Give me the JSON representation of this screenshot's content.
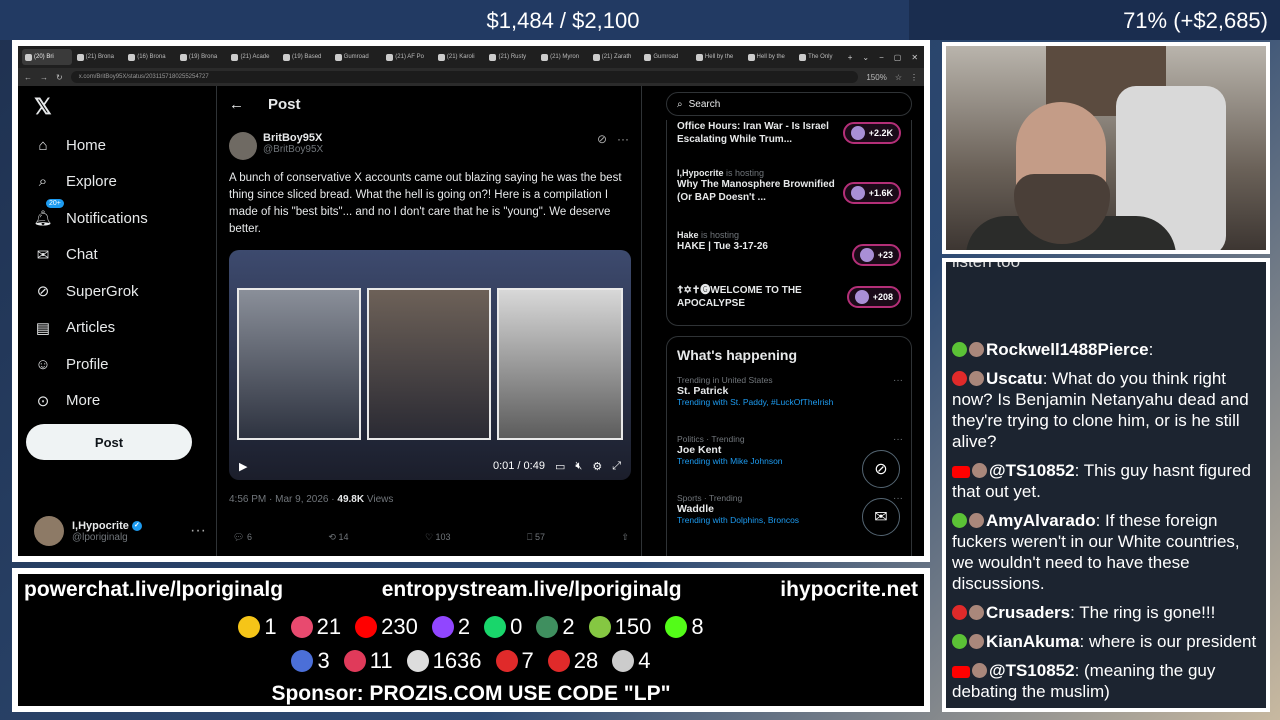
{
  "goal": {
    "amount": "$1,484 / $2,100",
    "percent": "71% (+$2,685)",
    "progress": 0.71
  },
  "browser": {
    "tabs": [
      "(20) Bri",
      "(21) Brona",
      "(16) Brona",
      "(19) Brona",
      "(21) Acade",
      "(19) Based",
      "Gumroad",
      "(21) AF Po",
      "(21) Karoli",
      "(21) Rusty",
      "(21) Myron",
      "(21) Zarath",
      "Gumroad",
      "Hell by the",
      "Hell by the",
      "The Only"
    ],
    "url": "x.com/BritBoy95X/status/2031157180255254727",
    "zoom": "150%"
  },
  "xnav": {
    "items": [
      {
        "label": "Home",
        "icon": "home-icon"
      },
      {
        "label": "Explore",
        "icon": "search-icon"
      },
      {
        "label": "Notifications",
        "icon": "bell-icon",
        "badge": "20+"
      },
      {
        "label": "Chat",
        "icon": "mail-icon"
      },
      {
        "label": "SuperGrok",
        "icon": "grok-icon"
      },
      {
        "label": "Articles",
        "icon": "articles-icon"
      },
      {
        "label": "Profile",
        "icon": "profile-icon"
      },
      {
        "label": "More",
        "icon": "more-icon"
      }
    ],
    "post_button": "Post",
    "me": {
      "name": "I,Hypocrite",
      "handle": "@lporiginalg"
    }
  },
  "post": {
    "header": "Post",
    "author_name": "BritBoy95X",
    "author_handle": "@BritBoy95X",
    "text": "A bunch of conservative X accounts came out blazing saying he was the best thing since sliced bread. What the hell is going on?! Here is a compilation I made of his \"best bits\"... and no I don't care that he is \"young\". We deserve better.",
    "video_time": "0:01 / 0:49",
    "timestamp": "4:56 PM · Mar 9, 2026 · ",
    "views_count": "49.8K",
    "views_label": " Views",
    "replies": "6",
    "reposts": "14",
    "likes": "103",
    "bookmarks": "57"
  },
  "rightcol": {
    "search_placeholder": "Search",
    "spaces": [
      {
        "host": "",
        "hosting": "",
        "title": "Office Hours: Iran War - Is Israel Escalating While Trum...",
        "count": "+2.2K"
      },
      {
        "host": "I,Hypocrite",
        "hosting": " is hosting",
        "title": "Why The Manosphere Brownified (Or BAP Doesn't ...",
        "count": "+1.6K"
      },
      {
        "host": "Hake",
        "hosting": " is hosting",
        "title": "HAKE | Tue 3-17-26",
        "count": "+23"
      },
      {
        "host": "",
        "hosting": "",
        "title": "☦✡✝🅖WELCOME TO THE APOCALYPSE",
        "count": "+208"
      }
    ],
    "happening_title": "What's happening",
    "trends": [
      {
        "cat": "Trending in United States",
        "name": "St. Patrick",
        "with_label": "Trending with ",
        "with": "St. Paddy, #LuckOfTheIrish"
      },
      {
        "cat": "Politics · Trending",
        "name": "Joe Kent",
        "with_label": "Trending with ",
        "with": "Mike Johnson"
      },
      {
        "cat": "Sports · Trending",
        "name": "Waddle",
        "with_label": "Trending with ",
        "with": "Dolphins, Broncos"
      }
    ]
  },
  "chat": {
    "cutoff": "listen too",
    "messages": [
      {
        "user": "Rockwell1488Pierce",
        "text": ": ",
        "platform": "rumble"
      },
      {
        "user": "Uscatu",
        "text": ": What do you think right now? Is Benjamin Netanyahu dead and they're trying to clone him, or is he still alive?",
        "platform": "odysee"
      },
      {
        "user": "@TS10852",
        "text": ": This guy hasnt figured that out yet.",
        "platform": "youtube"
      },
      {
        "user": "AmyAlvarado",
        "text": ": If these foreign fuckers weren't in our White countries, we wouldn't need to have these discussions.",
        "platform": "rumble"
      },
      {
        "user": "Crusaders",
        "text": ": The ring is gone!!!",
        "platform": "odysee"
      },
      {
        "user": "KianAkuma",
        "text": ": where is our president",
        "platform": "rumble"
      },
      {
        "user": "@TS10852",
        "text": ": (meaning the guy debating the muslim)",
        "platform": "youtube"
      }
    ]
  },
  "stats": {
    "links": [
      "powerchat.live/lporiginalg",
      "entropystream.live/lporiginalg",
      "ihypocrite.net"
    ],
    "row1": [
      {
        "icon": "emoji-icon",
        "color": "#f5c518",
        "value": "1"
      },
      {
        "icon": "pinwheel-icon",
        "color": "#e84a6f",
        "value": "21"
      },
      {
        "icon": "youtube-icon",
        "color": "#ff0000",
        "value": "230"
      },
      {
        "icon": "twitch-icon",
        "color": "#9146ff",
        "value": "2"
      },
      {
        "icon": "trovo-icon",
        "color": "#19d66b",
        "value": "0"
      },
      {
        "icon": "orb-icon",
        "color": "#3f8f5f",
        "value": "2"
      },
      {
        "icon": "rumble-icon",
        "color": "#85c742",
        "value": "150"
      },
      {
        "icon": "kick-icon",
        "color": "#53fc18",
        "value": "8"
      }
    ],
    "row2": [
      {
        "icon": "moon-icon",
        "color": "#4b6fd8",
        "value": "3"
      },
      {
        "icon": "pill-icon",
        "color": "#e03a5a",
        "value": "11"
      },
      {
        "icon": "x-icon",
        "color": "#dddddd",
        "value": "1636"
      },
      {
        "icon": "c-icon",
        "color": "#e02a2a",
        "value": "7"
      },
      {
        "icon": "odysee-icon",
        "color": "#e02a2a",
        "value": "28"
      },
      {
        "icon": "grid-icon",
        "color": "#cccccc",
        "value": "4"
      }
    ],
    "sponsor": "Sponsor: PROZIS.COM USE CODE \"LP\""
  }
}
